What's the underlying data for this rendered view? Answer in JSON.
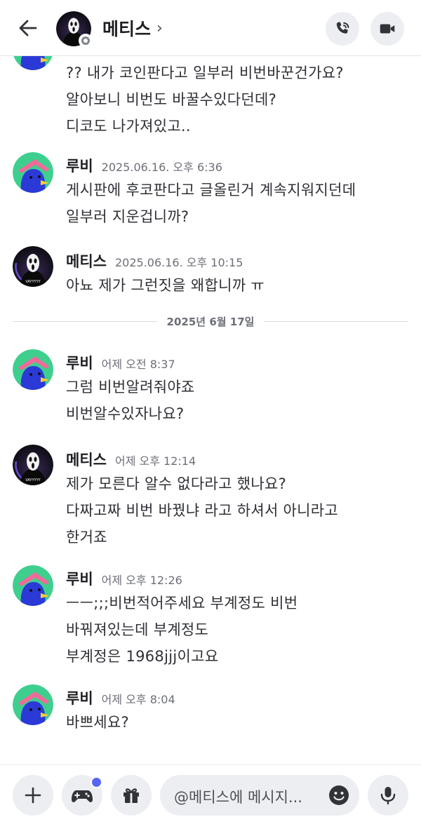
{
  "header": {
    "title": "메티스",
    "chevron": "›",
    "back_icon": "arrow-left-icon",
    "call_icon": "phone-icon",
    "video_icon": "video-camera-icon"
  },
  "messages": [
    {
      "author": "",
      "time": "",
      "avatar": "metis",
      "lines": [
        "?? 내가 코인판다고 일부러 비번바꾼건가요?",
        "알아보니 비번도 바꿀수있다던데?",
        "디코도 나가져있고.."
      ]
    },
    {
      "author": "루비",
      "time": "2025.06.16. 오후 6:36",
      "avatar": "rubi",
      "lines": [
        "게시판에 후코판다고 글올린거 계속지워지던데",
        "일부러 지운겁니까?"
      ]
    },
    {
      "author": "메티스",
      "time": "2025.06.16. 오후 10:15",
      "avatar": "metis",
      "lines": [
        "아뇨 제가 그런짓을 왜합니까 ㅠ"
      ]
    },
    {
      "author": "루비",
      "time": "어제 오전 8:37",
      "avatar": "rubi",
      "lines": [
        "그럼 비번알려줘야죠",
        "비번알수있자나요?"
      ]
    },
    {
      "author": "메티스",
      "time": "어제 오후 12:14",
      "avatar": "metis",
      "lines": [
        "제가 모른다 알수 없다라고 했나요?",
        "다짜고짜 비번 바꿨냐 라고 하셔서 아니라고",
        "한거죠"
      ]
    },
    {
      "author": "루비",
      "time": "어제 오후 12:26",
      "avatar": "rubi",
      "lines": [
        "ㅡㅡ;;;비번적어주세요 부계정도 비번",
        "바꿔져있는데 부계정도",
        "부계정은 1968jjj이고요"
      ]
    },
    {
      "author": "루비",
      "time": "어제 오후 8:04",
      "avatar": "rubi",
      "lines": [
        "바쁘세요?"
      ]
    }
  ],
  "date_divider": "2025년 6월 17일",
  "composer": {
    "placeholder": "@메티스에 메시지...",
    "plus_icon": "plus-icon",
    "game_icon": "gamepad-icon",
    "gift_icon": "gift-icon",
    "emoji_icon": "emoji-icon",
    "mic_icon": "microphone-icon",
    "accent_color": "#5865f2"
  },
  "avatar_text": "VAYYYYY",
  "colors": {
    "rubi_bg": "#3ecf8e",
    "rubi_body": "#2b3ad6",
    "rubi_hat": "#f06b9a",
    "metis_bg": "#17151c"
  }
}
